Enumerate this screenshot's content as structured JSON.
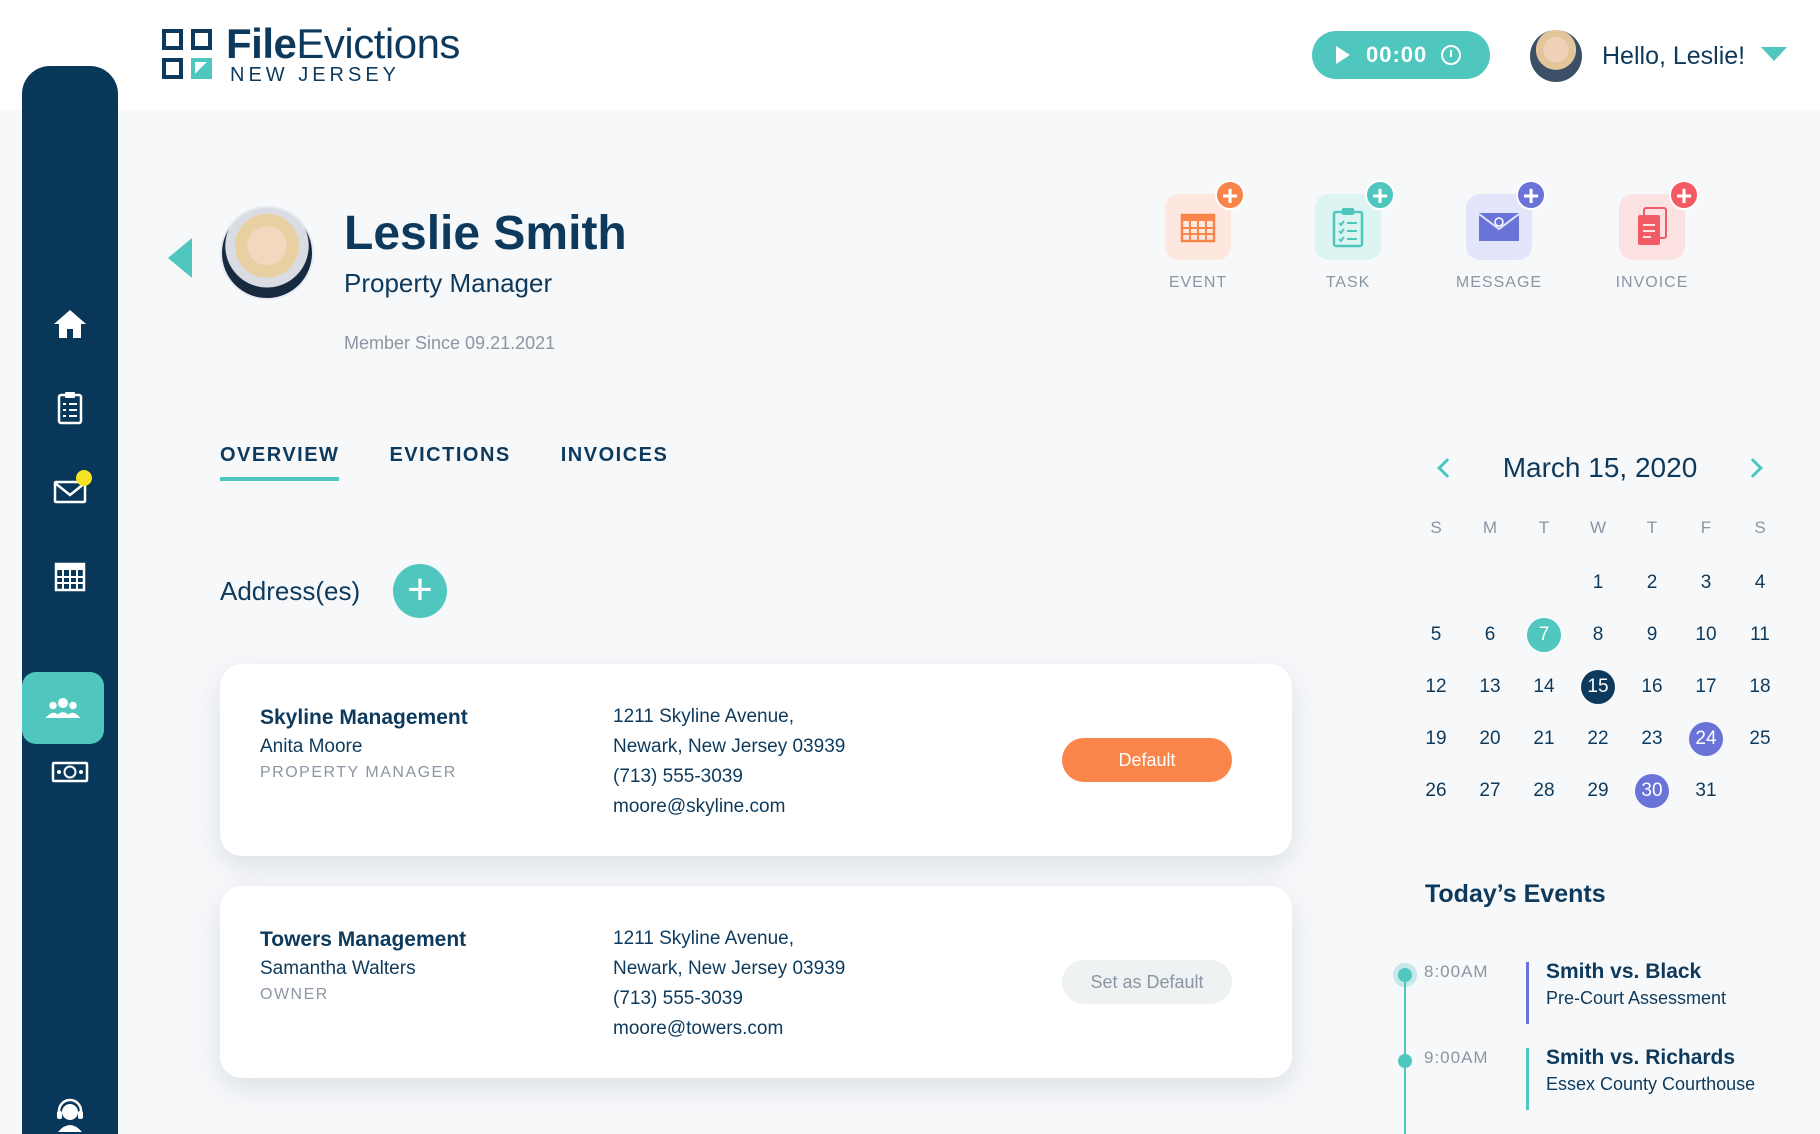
{
  "brand": {
    "name_bold": "File",
    "name_light": "Evictions",
    "region": "NEW JERSEY"
  },
  "timer": {
    "value": "00:00"
  },
  "user": {
    "greeting": "Hello, Leslie!"
  },
  "profile": {
    "name": "Leslie Smith",
    "role": "Property Manager",
    "member_since": "Member Since 09.21.2021"
  },
  "quick_actions": [
    {
      "label": "EVENT",
      "icon": "calendar-icon",
      "tile_color": "#fde7de",
      "plus_color": "#f9854a"
    },
    {
      "label": "TASK",
      "icon": "clipboard-icon",
      "tile_color": "#dcf4f2",
      "plus_color": "#4fc7bf"
    },
    {
      "label": "MESSAGE",
      "icon": "mail-icon",
      "tile_color": "#e3e6fa",
      "plus_color": "#6a74d8"
    },
    {
      "label": "INVOICE",
      "icon": "documents-icon",
      "tile_color": "#fde2e3",
      "plus_color": "#f25b64"
    }
  ],
  "tabs": [
    {
      "label": "OVERVIEW",
      "active": true
    },
    {
      "label": "EVICTIONS",
      "active": false
    },
    {
      "label": "INVOICES",
      "active": false
    }
  ],
  "addresses": {
    "title": "Address(es)",
    "cards": [
      {
        "company": "Skyline Management",
        "contact": "Anita Moore",
        "type": "PROPERTY MANAGER",
        "street": "1211 Skyline Avenue,",
        "city": "Newark, New Jersey 03939",
        "phone": "(713) 555-3039",
        "email": "moore@skyline.com",
        "button": "Default"
      },
      {
        "company": "Towers Management",
        "contact": "Samantha Walters",
        "type": "OWNER",
        "street": "1211 Skyline Avenue,",
        "city": "Newark, New Jersey 03939",
        "phone": "(713) 555-3039",
        "email": "moore@towers.com",
        "button": "Set as Default"
      }
    ]
  },
  "calendar": {
    "title": "March 15, 2020",
    "weekdays": [
      "S",
      "M",
      "T",
      "W",
      "T",
      "F",
      "S"
    ],
    "leading_blanks": 3,
    "days": 31,
    "highlights": {
      "7": "teal",
      "15": "navy",
      "24": "purple",
      "30": "purple"
    }
  },
  "events": {
    "title": "Today’s Events",
    "items": [
      {
        "time": "8:00AM",
        "title": "Smith vs. Black",
        "subtitle": "Pre-Court Assessment",
        "color": "#6a74d8"
      },
      {
        "time": "9:00AM",
        "title": "Smith vs. Richards",
        "subtitle": "Essex County Courthouse",
        "color": "#4fc7bf"
      }
    ]
  },
  "sidebar": {
    "items": [
      {
        "icon": "home-icon"
      },
      {
        "icon": "clipboard-icon"
      },
      {
        "icon": "mail-icon",
        "badge": true
      },
      {
        "icon": "calendar-icon"
      },
      {
        "icon": "users-icon",
        "active": true
      },
      {
        "icon": "money-icon"
      },
      {
        "icon": "support-icon"
      }
    ]
  }
}
